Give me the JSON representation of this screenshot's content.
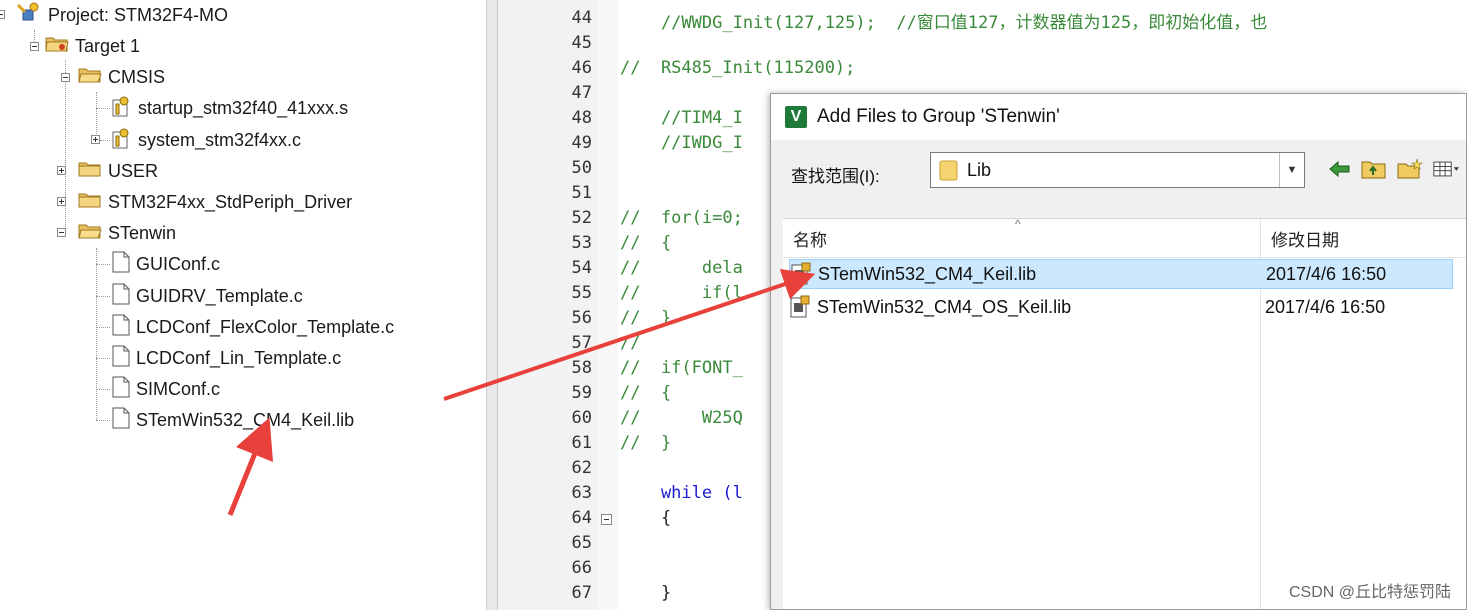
{
  "project_tree": {
    "project_label": "Project: STM32F4-MO",
    "target_label": "Target 1",
    "groups": [
      {
        "label": "CMSIS",
        "files": [
          "startup_stm32f40_41xxx.s",
          "system_stm32f4xx.c"
        ]
      },
      {
        "label": "USER"
      },
      {
        "label": "STM32F4xx_StdPeriph_Driver"
      },
      {
        "label": "STenwin",
        "files": [
          "GUIConf.c",
          "GUIDRV_Template.c",
          "LCDConf_FlexColor_Template.c",
          "LCDConf_Lin_Template.c",
          "SIMConf.c",
          "STemWin532_CM4_Keil.lib"
        ]
      }
    ]
  },
  "editor": {
    "lines": [
      {
        "n": "44",
        "code": "    //WWDG_Init(127,125);  //窗口值127，计数器值为125，即初始化值，也"
      },
      {
        "n": "45",
        "code": ""
      },
      {
        "n": "46",
        "code": "//  RS485_Init(115200);"
      },
      {
        "n": "47",
        "code": ""
      },
      {
        "n": "48",
        "code": "    //TIM4_I"
      },
      {
        "n": "49",
        "code": "    //IWDG_I"
      },
      {
        "n": "50",
        "code": ""
      },
      {
        "n": "51",
        "code": ""
      },
      {
        "n": "52",
        "code": "//  for(i=0;"
      },
      {
        "n": "53",
        "code": "//  {"
      },
      {
        "n": "54",
        "code": "//      dela"
      },
      {
        "n": "55",
        "code": "//      if(l"
      },
      {
        "n": "56",
        "code": "//  }"
      },
      {
        "n": "57",
        "code": "//"
      },
      {
        "n": "58",
        "code": "//  if(FONT_"
      },
      {
        "n": "59",
        "code": "//  {"
      },
      {
        "n": "60",
        "code": "//      W25Q"
      },
      {
        "n": "61",
        "code": "//  }"
      },
      {
        "n": "62",
        "code": ""
      },
      {
        "n": "63",
        "code": "    while (l"
      },
      {
        "n": "64",
        "code": "    {"
      },
      {
        "n": "65",
        "code": ""
      },
      {
        "n": "66",
        "code": ""
      },
      {
        "n": "67",
        "code": "    }"
      }
    ]
  },
  "dialog": {
    "title": "Add Files to Group 'STenwin'",
    "look_in_label": "查找范围(I):",
    "look_in_value": "Lib",
    "columns": {
      "name": "名称",
      "date": "修改日期"
    },
    "files": [
      {
        "name": "STemWin532_CM4_Keil.lib",
        "date": "2017/4/6 16:50",
        "selected": true
      },
      {
        "name": "STemWin532_CM4_OS_Keil.lib",
        "date": "2017/4/6 16:50",
        "selected": false
      }
    ]
  },
  "watermark": "CSDN @丘比特惩罚陆",
  "colors": {
    "arrow": "#e8403a",
    "comment": "#3a8a3a",
    "keyword": "#1a1ad0",
    "selection": "#cce8ff"
  }
}
